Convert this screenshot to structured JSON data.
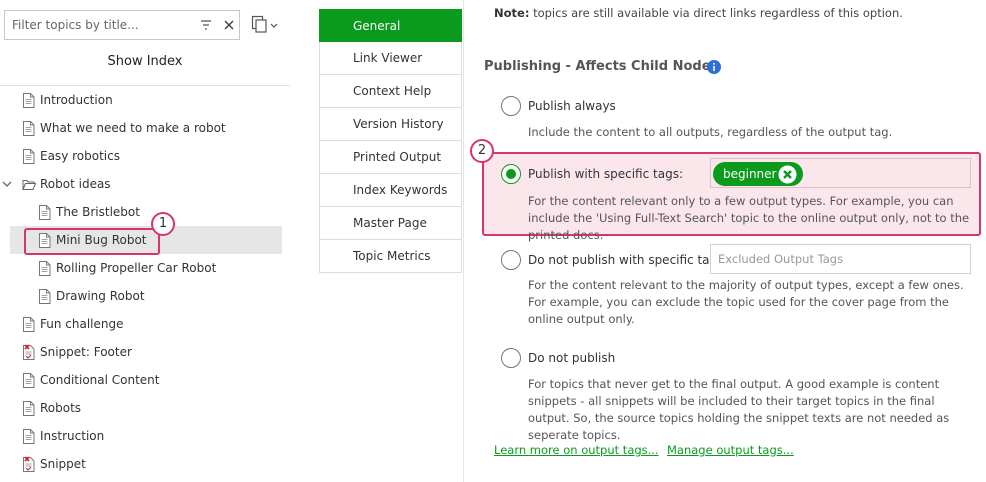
{
  "filter": {
    "placeholder": "Filter topics by title..."
  },
  "show_index_label": "Show Index",
  "tree": [
    {
      "label": "Introduction",
      "icon": "document-icon"
    },
    {
      "label": "What we need to make a robot",
      "icon": "document-icon"
    },
    {
      "label": "Easy robotics",
      "icon": "document-icon"
    },
    {
      "label": "Robot ideas",
      "icon": "open-folder-icon",
      "expanded": true
    },
    {
      "label": "The Bristlebot",
      "icon": "document-icon"
    },
    {
      "label": "Mini Bug Robot",
      "icon": "document-icon",
      "selected": true
    },
    {
      "label": "Rolling Propeller Car Robot",
      "icon": "document-icon"
    },
    {
      "label": "Drawing Robot",
      "icon": "document-icon"
    },
    {
      "label": "Fun challenge",
      "icon": "document-icon"
    },
    {
      "label": "Snippet: Footer",
      "icon": "snippet-icon"
    },
    {
      "label": "Conditional Content",
      "icon": "document-icon"
    },
    {
      "label": "Robots",
      "icon": "document-icon"
    },
    {
      "label": "Instruction",
      "icon": "document-icon"
    },
    {
      "label": "Snippet",
      "icon": "snippet-icon"
    }
  ],
  "callouts": {
    "one": "1",
    "two": "2"
  },
  "tabs": [
    {
      "label": "General",
      "active": true
    },
    {
      "label": "Link Viewer"
    },
    {
      "label": "Context Help"
    },
    {
      "label": "Version History"
    },
    {
      "label": "Printed Output"
    },
    {
      "label": "Index Keywords"
    },
    {
      "label": "Master Page"
    },
    {
      "label": "Topic Metrics"
    }
  ],
  "note": {
    "bold": "Note:",
    "text": " topics are still available via direct links regardless of this option."
  },
  "section_title": "Publishing - Affects Child Nodes",
  "options": {
    "always": {
      "label": "Publish always",
      "desc": "Include the content to all outputs, regardless of the output tag."
    },
    "specific": {
      "label": "Publish with specific tags:",
      "desc": "For the content relevant only to a few output types. For example, you can include the 'Using Full-Text Search' topic to the online output only, not to the printed docs.",
      "tag": "beginner"
    },
    "not_specific": {
      "label": "Do not publish with specific tags:",
      "placeholder": "Excluded Output Tags",
      "desc": "For the content relevant to the majority of output types, except a few ones. For example, you can exclude the topic used for the cover page from the online output only."
    },
    "never": {
      "label": "Do not publish",
      "desc": "For topics that never get to the final output. A good example is content snippets - all snippets will be included to their target topics in the final output. So, the source topics holding the snippet texts are not needed as seperate topics."
    }
  },
  "links": {
    "learn_more": "Learn more on output tags...",
    "manage": "Manage output tags..."
  },
  "colors": {
    "accent_green": "#0a9b1d",
    "callout_pink": "#d7356d",
    "highlight_bg": "#fbe6ec",
    "info_blue": "#2f6fd6"
  }
}
